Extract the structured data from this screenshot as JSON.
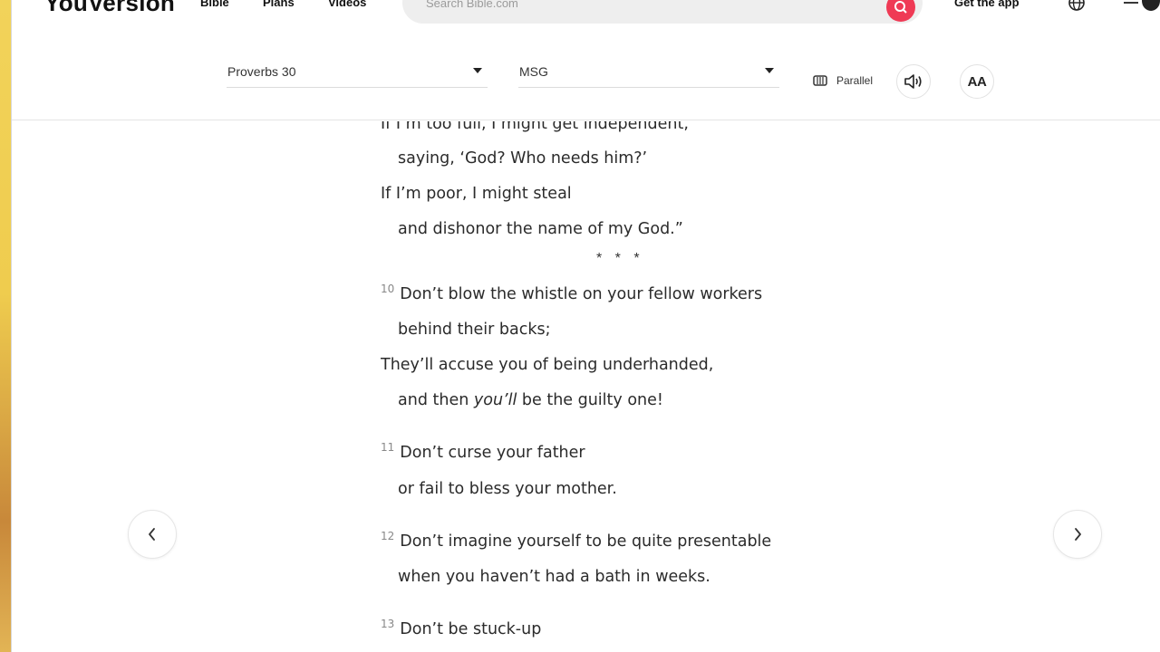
{
  "topnav": {
    "logo": "YouVersion",
    "links": [
      "Bible",
      "Plans",
      "Videos"
    ],
    "search_placeholder": "Search Bible.com",
    "get_app": "Get the app"
  },
  "toolbar": {
    "book_chapter": "Proverbs 30",
    "version": "MSG",
    "parallel_label": "Parallel",
    "font_size_label": "AA"
  },
  "passage": {
    "lines": [
      {
        "text": "If I’m too full, I might get independent,"
      },
      {
        "text": "saying, ‘God? Who needs him?’"
      },
      {
        "text": "If I’m poor, I might steal"
      },
      {
        "text": "and dishonor the name of my God.”"
      }
    ],
    "separator": "* * *",
    "verse10": {
      "num": "10",
      "l1": "Don’t blow the whistle on your fellow workers",
      "l2": "behind their backs;",
      "l3": "They’ll accuse you of being underhanded,",
      "l4_a": "and then ",
      "l4_em": "you’ll",
      "l4_b": " be the guilty one!"
    },
    "verse11": {
      "num": "11",
      "l1": "Don’t curse your father",
      "l2": "or fail to bless your mother."
    },
    "verse12": {
      "num": "12",
      "l1": "Don’t imagine yourself to be quite presentable",
      "l2": "when you haven’t had a bath in weeks."
    },
    "verse13": {
      "num": "13",
      "l1": "Don’t be stuck-up"
    }
  },
  "colors": {
    "accent": "#ef3a55",
    "text": "#2b2b2b"
  },
  "icons": [
    "search-icon",
    "globe-icon",
    "menu-icon",
    "parallel-icon",
    "audio-icon",
    "chevron-left-icon",
    "chevron-right-icon"
  ]
}
